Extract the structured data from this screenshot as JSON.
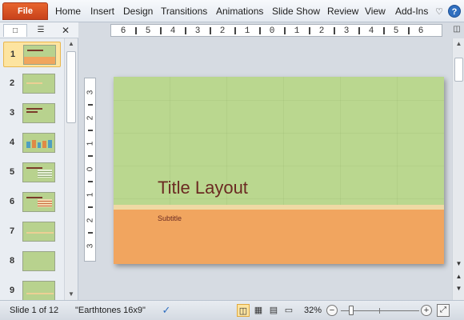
{
  "ribbon": {
    "file_label": "File",
    "tabs": [
      "Home",
      "Insert",
      "Design",
      "Transitions",
      "Animations",
      "Slide Show",
      "Review",
      "View",
      "Add-Ins"
    ]
  },
  "panel": {
    "close_glyph": "✕",
    "slide_numbers": [
      "1",
      "2",
      "3",
      "4",
      "5",
      "6",
      "7",
      "8",
      "9"
    ]
  },
  "rulers": {
    "horizontal": [
      "6",
      "5",
      "4",
      "3",
      "2",
      "1",
      "0",
      "1",
      "2",
      "3",
      "4",
      "5",
      "6"
    ],
    "vertical": [
      "3",
      "2",
      "1",
      "0",
      "1",
      "2",
      "3"
    ]
  },
  "slide": {
    "title": "Title Layout",
    "subtitle": "Subtitle"
  },
  "status": {
    "slide_info": "Slide 1 of 12",
    "theme": "\"Earthtones 16x9\"",
    "zoom": "32%",
    "zoom_percent": 32
  },
  "colors": {
    "file_tab": "#d24f24",
    "slide_green": "#bad78f",
    "slide_orange": "#f1a55f",
    "title_text": "#6b2a22",
    "selection": "#fde4a0"
  }
}
